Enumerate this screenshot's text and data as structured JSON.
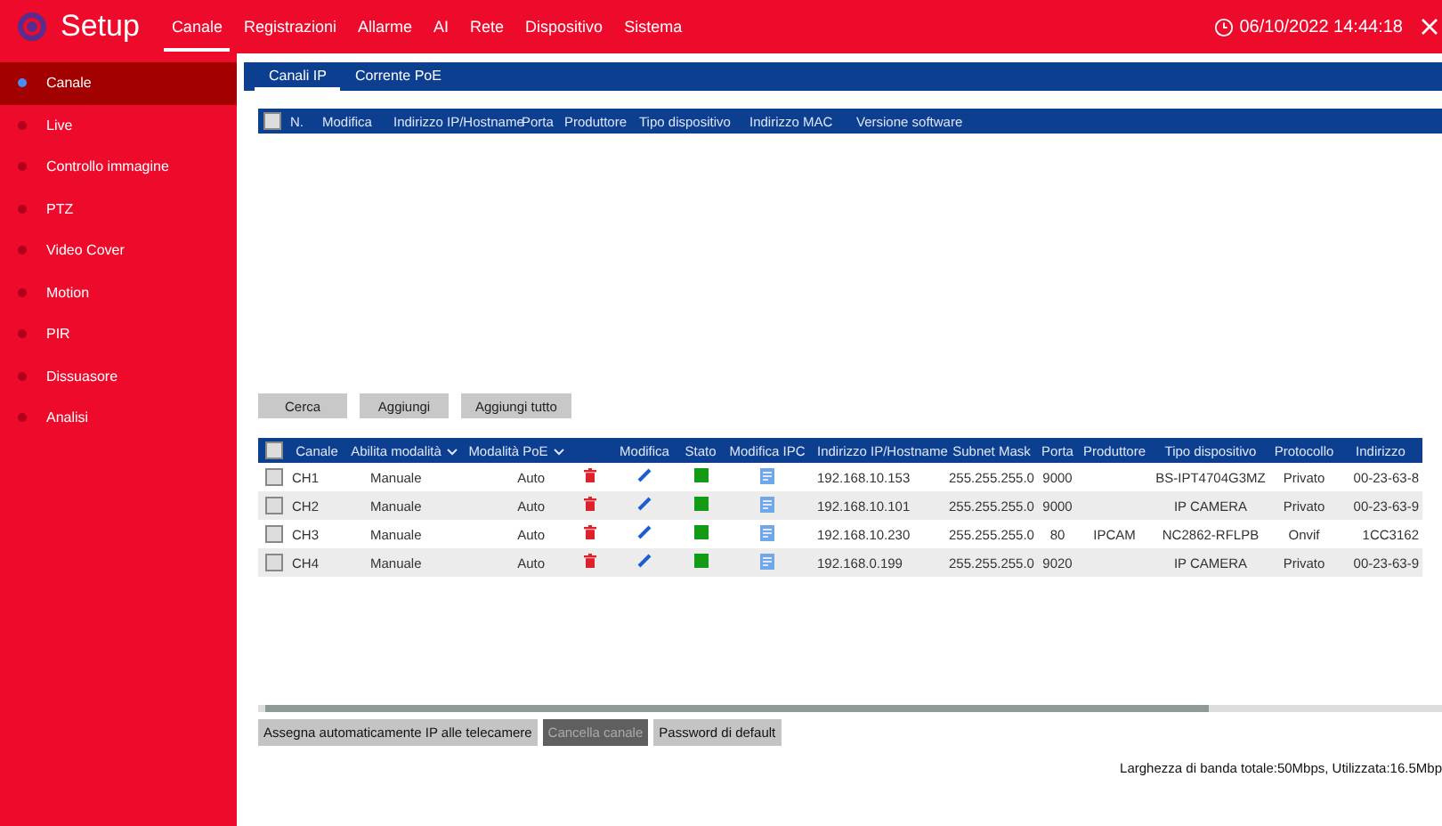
{
  "header": {
    "title": "Setup",
    "menu": [
      {
        "label": "Canale",
        "selected": true
      },
      {
        "label": "Registrazioni",
        "selected": false
      },
      {
        "label": "Allarme",
        "selected": false
      },
      {
        "label": "AI",
        "selected": false
      },
      {
        "label": "Rete",
        "selected": false
      },
      {
        "label": "Dispositivo",
        "selected": false
      },
      {
        "label": "Sistema",
        "selected": false
      }
    ],
    "datetime": "06/10/2022 14:44:18"
  },
  "sidebar": {
    "items": [
      {
        "label": "Canale",
        "selected": true
      },
      {
        "label": "Live",
        "selected": false
      },
      {
        "label": "Controllo immagine",
        "selected": false
      },
      {
        "label": "PTZ",
        "selected": false
      },
      {
        "label": "Video Cover",
        "selected": false
      },
      {
        "label": "Motion",
        "selected": false
      },
      {
        "label": "PIR",
        "selected": false
      },
      {
        "label": "Dissuasore",
        "selected": false
      },
      {
        "label": "Analisi",
        "selected": false
      }
    ]
  },
  "subtabs": [
    {
      "label": "Canali IP",
      "selected": true
    },
    {
      "label": "Corrente PoE",
      "selected": false
    }
  ],
  "search_table": {
    "all_checked": false,
    "columns": [
      "N.",
      "Modifica",
      "Indirizzo IP/Hostname",
      "Porta",
      "Produttore",
      "Tipo dispositivo",
      "Indirizzo MAC",
      "Versione software"
    ]
  },
  "search_buttons": [
    "Cerca",
    "Aggiungi",
    "Aggiungi tutto"
  ],
  "channel_table": {
    "all_checked": false,
    "columns": [
      {
        "label": "Canale",
        "dropdown": false
      },
      {
        "label": "Abilita modalità",
        "dropdown": true
      },
      {
        "label": "Modalità PoE",
        "dropdown": true
      },
      {
        "label": "Modifica",
        "dropdown": false
      },
      {
        "label": "Stato",
        "dropdown": false
      },
      {
        "label": "Modifica IPC",
        "dropdown": false
      },
      {
        "label": "Indirizzo IP/Hostname",
        "dropdown": false
      },
      {
        "label": "Subnet Mask",
        "dropdown": false
      },
      {
        "label": "Porta",
        "dropdown": false
      },
      {
        "label": "Produttore",
        "dropdown": false
      },
      {
        "label": "Tipo dispositivo",
        "dropdown": false
      },
      {
        "label": "Protocollo",
        "dropdown": false
      },
      {
        "label": "Indirizzo",
        "dropdown": false
      }
    ],
    "rows": [
      {
        "checked": false,
        "online": true,
        "channel": "CH1",
        "mode": "Manuale",
        "poe": "Auto",
        "ip": "192.168.10.153",
        "mask": "255.255.255.0",
        "port": "9000",
        "maker": "",
        "type": "BS-IPT4704G3MZ",
        "protocol": "Privato",
        "mac": "00-23-63-8"
      },
      {
        "checked": false,
        "online": true,
        "channel": "CH2",
        "mode": "Manuale",
        "poe": "Auto",
        "ip": "192.168.10.101",
        "mask": "255.255.255.0",
        "port": "9000",
        "maker": "",
        "type": "IP CAMERA",
        "protocol": "Privato",
        "mac": "00-23-63-9"
      },
      {
        "checked": false,
        "online": true,
        "channel": "CH3",
        "mode": "Manuale",
        "poe": "Auto",
        "ip": "192.168.10.230",
        "mask": "255.255.255.0",
        "port": "80",
        "maker": "IPCAM",
        "type": "NC2862-RFLPB",
        "protocol": "Onvif",
        "mac": "1CC3162"
      },
      {
        "checked": false,
        "online": true,
        "channel": "CH4",
        "mode": "Manuale",
        "poe": "Auto",
        "ip": "192.168.0.199",
        "mask": "255.255.255.0",
        "port": "9020",
        "maker": "",
        "type": "IP CAMERA",
        "protocol": "Privato",
        "mac": "00-23-63-9"
      }
    ]
  },
  "bottom_buttons": [
    {
      "label": "Assegna automaticamente IP alle telecamere",
      "disabled": false
    },
    {
      "label": "Cancella canale",
      "disabled": true
    },
    {
      "label": "Password di default",
      "disabled": false
    }
  ],
  "bandwidth": "Larghezza di banda totale:50Mbps, Utilizzata:16.5Mbp"
}
